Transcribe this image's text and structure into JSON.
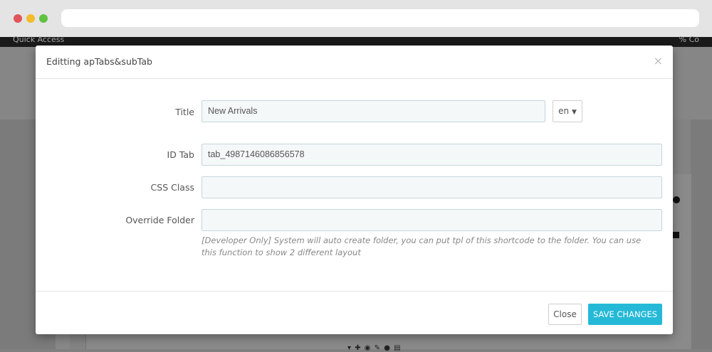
{
  "background": {
    "topbar_left": "Quick Access",
    "topbar_right": "% Co"
  },
  "modal": {
    "title": "Editting apTabs&subTab",
    "close_symbol": "×",
    "fields": {
      "title_label": "Title",
      "title_value": "New Arrivals",
      "language": "en",
      "language_caret": "▼",
      "id_tab_label": "ID Tab",
      "id_tab_value": "tab_4987146086856578",
      "css_class_label": "CSS Class",
      "css_class_value": "",
      "override_folder_label": "Override Folder",
      "override_folder_value": "",
      "override_folder_help": "[Developer Only] System will auto create folder, you can put tpl of this shortcode to the folder. You can use this function to show 2 different layout"
    },
    "footer": {
      "close_label": "Close",
      "save_label": "SAVE CHANGES"
    }
  },
  "colors": {
    "accent": "#25b9d7",
    "input_bg": "#f5f8f9",
    "input_border": "#c7d6db"
  }
}
